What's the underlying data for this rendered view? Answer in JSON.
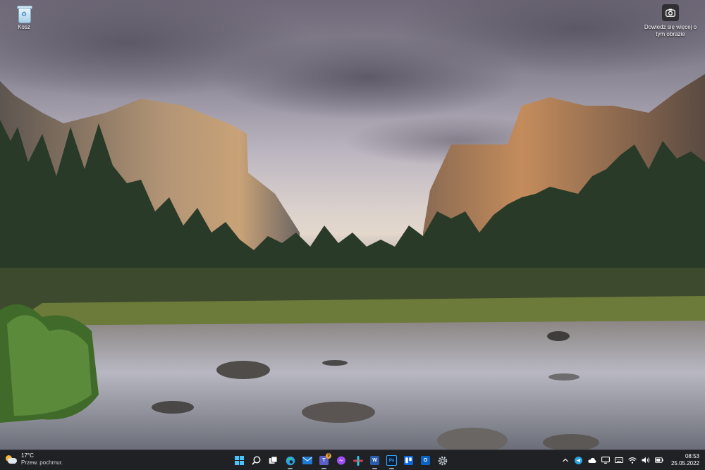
{
  "desktop": {
    "recycle_bin_label": "Kosz",
    "spotlight_text": "Dowiedz się więcej o tym obrazie"
  },
  "taskbar": {
    "weather": {
      "temperature": "17°C",
      "condition": "Przew. pochmur."
    },
    "pinned_apps": [
      {
        "name": "windows-start",
        "color": "#4cc2ff"
      },
      {
        "name": "search",
        "color": "#ffffff"
      },
      {
        "name": "task-view",
        "color": "#ffffff"
      },
      {
        "name": "edge",
        "color": "#2ba0e0"
      },
      {
        "name": "mail",
        "color": "#1f7ad6"
      },
      {
        "name": "teams",
        "color": "#5b5fc7"
      },
      {
        "name": "messenger",
        "color": "#a14df5"
      },
      {
        "name": "slack",
        "color": "#e0345e"
      },
      {
        "name": "word",
        "color": "#2b5cab",
        "glyph": "W"
      },
      {
        "name": "photoshop",
        "color": "#0b1e38",
        "glyph": "Ps"
      },
      {
        "name": "trello",
        "color": "#0c66e4"
      },
      {
        "name": "outlook",
        "color": "#0a64c4",
        "glyph": "O"
      },
      {
        "name": "settings",
        "color": "#9aa4b0"
      }
    ],
    "teams_badge": "9",
    "tray": {
      "time": "08:53",
      "date": "25.05.2022"
    }
  }
}
